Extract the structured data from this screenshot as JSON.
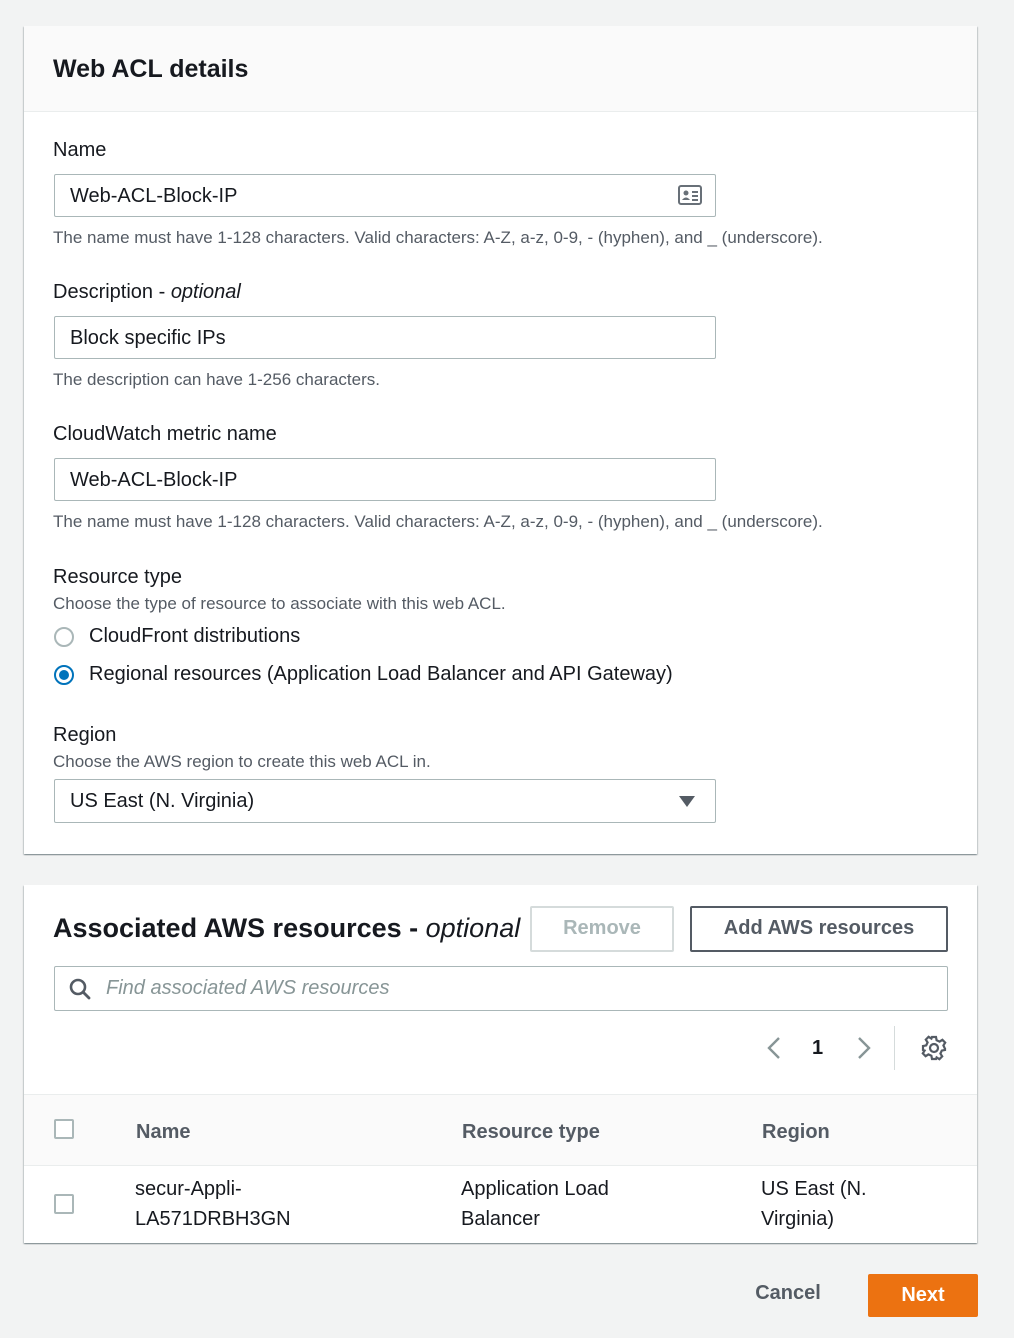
{
  "details": {
    "title": "Web ACL details",
    "name": {
      "label": "Name",
      "value": "Web-ACL-Block-IP",
      "hint": "The name must have 1-128 characters. Valid characters: A-Z, a-z, 0-9, - (hyphen), and _ (underscore)."
    },
    "description": {
      "label": "Description - ",
      "label_optional": "optional",
      "value": "Block specific IPs",
      "hint": "The description can have 1-256 characters."
    },
    "metric": {
      "label": "CloudWatch metric name",
      "value": "Web-ACL-Block-IP",
      "hint": "The name must have 1-128 characters. Valid characters: A-Z, a-z, 0-9, - (hyphen), and _ (underscore)."
    },
    "resource_type": {
      "label": "Resource type",
      "hint": "Choose the type of resource to associate with this web ACL.",
      "options": [
        {
          "label": "CloudFront distributions",
          "checked": false
        },
        {
          "label": "Regional resources (Application Load Balancer and API Gateway)",
          "checked": true
        }
      ]
    },
    "region": {
      "label": "Region",
      "hint": "Choose the AWS region to create this web ACL in.",
      "selected": "US East (N. Virginia)"
    }
  },
  "resources": {
    "title": "Associated AWS resources - ",
    "title_optional": "optional",
    "remove_label": "Remove",
    "add_label": "Add AWS resources",
    "search_placeholder": "Find associated AWS resources",
    "page": "1",
    "columns": [
      "Name",
      "Resource type",
      "Region"
    ],
    "rows": [
      {
        "name": [
          "secur-Appli-",
          "LA571DRBH3GN"
        ],
        "type": [
          "Application Load",
          "Balancer"
        ],
        "region": [
          "US East (N.",
          "Virginia)"
        ]
      }
    ]
  },
  "footer": {
    "cancel_label": "Cancel",
    "next_label": "Next"
  },
  "colors": {
    "primary": "#ec7211",
    "radio_selected": "#0073bb"
  }
}
